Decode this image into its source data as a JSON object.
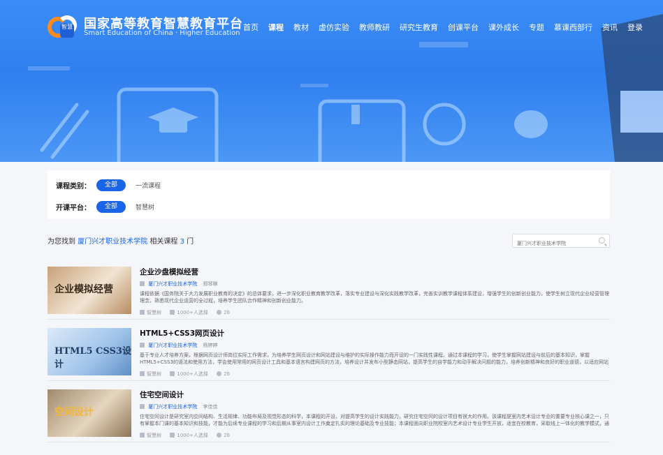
{
  "header": {
    "brand_cn": "国家高等教育智慧教育平台",
    "brand_en": "Smart Education of China · Higher Education",
    "nav": [
      {
        "label": "首页",
        "active": false
      },
      {
        "label": "课程",
        "active": true
      },
      {
        "label": "教材",
        "active": false
      },
      {
        "label": "虚仿实验",
        "active": false
      },
      {
        "label": "教师教研",
        "active": false
      },
      {
        "label": "研究生教育",
        "active": false
      },
      {
        "label": "创课平台",
        "active": false
      },
      {
        "label": "课外成长",
        "active": false
      },
      {
        "label": "专题",
        "active": false
      },
      {
        "label": "慕课西部行",
        "active": false
      },
      {
        "label": "资讯",
        "active": false
      },
      {
        "label": "登录",
        "active": false
      }
    ]
  },
  "filters": {
    "category_label": "课程类别：",
    "category_selected": "全部",
    "category_option": "一流课程",
    "platform_label": "开课平台：",
    "platform_selected": "全部",
    "platform_option": "智慧树"
  },
  "result": {
    "prefix": "为您找到",
    "school": "厦门兴才职业技术学院",
    "middle": "相关课程",
    "count": "3",
    "suffix": "门"
  },
  "search": {
    "placeholder": "厦门兴才职业技术学院"
  },
  "courses": [
    {
      "title": "企业沙盘模拟经营",
      "school": "厦门兴才职业技术学院",
      "teacher": "郑琴琳",
      "desc": "课程依据《国务院关于大力发展职业教育的决定》的总体要求，进一步深化职业教育教学改革，落实专业建设与深化实践教学改革，完善实训教学课程体系建设，增强学生的创新创业能力，使学生树立现代企业经营管理理念，熟悉现代企业运营的全过程，培养学生团队合作精神和创新创业能力。",
      "platform": "智慧树",
      "learners": "1000+人选择",
      "lessons": "26",
      "thumb_text": "企业模拟经营"
    },
    {
      "title": "HTML5+CSS3网页设计",
      "school": "厦门兴才职业技术学院",
      "teacher": "杨婷婷",
      "desc": "基于专业人才培养方案，根据网页设计师岗位实际工作需求，为培养学生网页设计和网站建设与维护的实际操作能力而开设的一门实践性课程。通过本课程的学习，使学生掌握网站建设与前后的基本知识，掌握HTML5+CSS3的语法和使用方法，学会使用常用的网页设计工具和基本语言构建网页的方法，培养设计并发布小型静态网站，提高学生的自学能力和动手解决问题的能力，培养创新精神和良好的职业道德，以适应网站建设相关岗位群的实际工作需要。",
      "platform": "智慧树",
      "learners": "1000+人选择",
      "lessons": "26",
      "thumb_text": "HTML5 CSS3设计"
    },
    {
      "title": "住宅空间设计",
      "school": "厦门兴才职业技术学院",
      "teacher": "李佳佳",
      "desc": "住宅空间设计是研究室内空间结构、生活规律、功能布局及视觉形态的科学，本课程的开设，对提高学生的设计实践能力，研究住宅空间的设计项目有很大的作用。该课程是室内艺术设计专业的重要专业核心课之一，只有掌握本门课的基本知识和技能，才能为后续专业课程的学习和后期从事室内设计工作奠定扎实的理论基础及专业技能；本课程面向职业院校室内艺术设计专业学生开放，适宜在校教育，采取线上一体化的教学模式，通过开放线上线下融合…",
      "platform": "智慧树",
      "learners": "1000+人选择",
      "lessons": "26",
      "thumb_text": "空间设计"
    }
  ],
  "colors": {
    "brand_blue": "#1a64e8",
    "banner_blue": "#3b8cf6",
    "logo_orange": "#ff8a1e"
  }
}
